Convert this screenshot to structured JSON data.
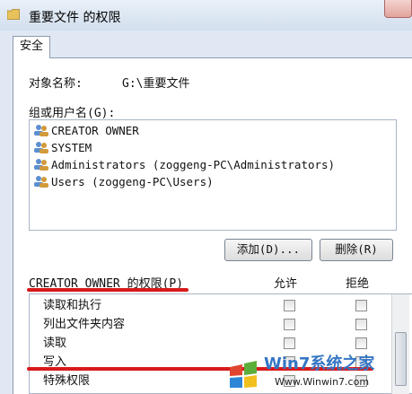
{
  "window": {
    "title": "重要文件 的权限"
  },
  "tabs": [
    {
      "label": "安全"
    }
  ],
  "object": {
    "label": "对象名称:",
    "value": "G:\\重要文件"
  },
  "users_group": {
    "label": "组或用户名(G):",
    "items": [
      {
        "name": "CREATOR OWNER"
      },
      {
        "name": "SYSTEM"
      },
      {
        "name": "Administrators (zoggeng-PC\\Administrators)"
      },
      {
        "name": "Users (zoggeng-PC\\Users)"
      }
    ]
  },
  "buttons": {
    "add": "添加(D)...",
    "remove": "删除(R)"
  },
  "permissions": {
    "header": "CREATOR OWNER 的权限(P)",
    "allow_label": "允许",
    "deny_label": "拒绝",
    "rows": [
      {
        "label": "读取和执行"
      },
      {
        "label": "列出文件夹内容"
      },
      {
        "label": "读取"
      },
      {
        "label": "写入"
      },
      {
        "label": "特殊权限"
      }
    ]
  },
  "watermark": {
    "brand": "Win7系统之家",
    "url": "Www.Winwin7.com"
  },
  "colors": {
    "annotation_red": "#d81a1a",
    "titlebar": "#dce6f2"
  }
}
